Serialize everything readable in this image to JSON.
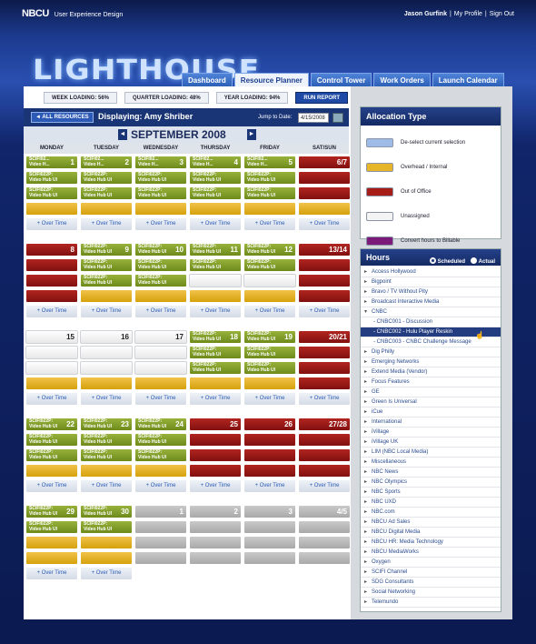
{
  "brand": {
    "logo": "NBCU",
    "subtitle": "User Experience Design",
    "app_name": "LIGHTHOUSE"
  },
  "user": {
    "name": "Jason Gurfink",
    "my_profile": "My Profile",
    "sign_out": "Sign Out",
    "separator": "|"
  },
  "tabs": [
    {
      "label": "Dashboard",
      "active": false
    },
    {
      "label": "Resource Planner",
      "active": true
    },
    {
      "label": "Control Tower",
      "active": false
    },
    {
      "label": "Work Orders",
      "active": false
    },
    {
      "label": "Launch Calendar",
      "active": false
    }
  ],
  "loading": {
    "week": "WEEK LOADING: 56%",
    "quarter": "QUARTER LOADING: 48%",
    "year": "YEAR LOADING: 94%",
    "run_report": "RUN REPORT"
  },
  "calendar_bar": {
    "all_resources": "◄ ALL RESOURCES",
    "displaying": "Displaying: Amy Shriber",
    "jump_label": "Jump to Date:",
    "jump_value": "4/15/2008"
  },
  "month": {
    "title": "SEPTEMBER 2008",
    "prev": "◄",
    "next": "►"
  },
  "days": [
    "MONDAY",
    "TUESDAY",
    "WEDNESDAY",
    "THURSDAY",
    "FRIDAY",
    "SAT/SUN"
  ],
  "entries": {
    "video_h_1": "SCIFI02...",
    "video_h_2": "Video H...",
    "hub_1": "SCIFI022P:",
    "hub_2": "Video Hub UI",
    "over_time": "+ Over Time"
  },
  "weeks": [
    {
      "nums": [
        "1",
        "2",
        "3",
        "4",
        "5",
        "6/7"
      ]
    },
    {
      "nums": [
        "8",
        "9",
        "10",
        "11",
        "12",
        "13/14"
      ]
    },
    {
      "nums": [
        "15",
        "16",
        "17",
        "18",
        "19",
        "20/21"
      ]
    },
    {
      "nums": [
        "22",
        "23",
        "24",
        "25",
        "26",
        "27/28"
      ]
    },
    {
      "nums": [
        "29",
        "30",
        "1",
        "2",
        "3",
        "4/5"
      ]
    }
  ],
  "allocation": {
    "title": "Allocation Type",
    "items": [
      {
        "label": "De-select current selection",
        "color": "#9fbbe8"
      },
      {
        "label": "Overhead / Internal",
        "color": "#e6b628"
      },
      {
        "label": "Out of Office",
        "color": "#a51d16"
      },
      {
        "label": "Unassigned",
        "color": "#f4f4f4"
      },
      {
        "label": "Convert hours to Billable",
        "color": "#7c1a7a"
      }
    ]
  },
  "hours": {
    "title": "Hours",
    "scheduled": "Scheduled",
    "actual": "Actual",
    "items": [
      "Access Hollywood",
      "Bigpoint",
      "Bravo / TV Without Pity",
      "Broadcast Interactive Media",
      "CNBC",
      "- CNBC001 - Discussion",
      "- CNBC002 - Hulu Player Reskin",
      "- CNBC003 - CNBC Challenge Message",
      "Dig Philly",
      "Emerging Networks",
      "Extend Media (Vendor)",
      "Focus Features",
      "GE",
      "Green Is Universal",
      "iCue",
      "International",
      "iVillage",
      "iVillage UK",
      "LIM (NBC Local Media)",
      "Miscellaneous",
      "NBC News",
      "NBC Olympics",
      "NBC Sports",
      "NBC UXD",
      "NBC.com",
      "NBCU Ad Sales",
      "NBCU Digital Media",
      "NBCU HR: Media Technology",
      "NBCU MediaWorks",
      "Oxygen",
      "SCIFI Channel",
      "SDG Consultants",
      "Social Networking",
      "Telemundo"
    ]
  }
}
